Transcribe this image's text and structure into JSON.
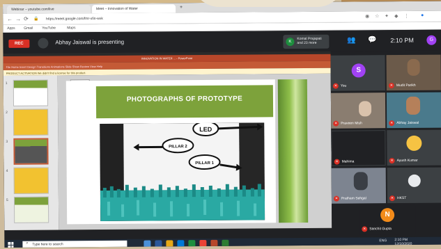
{
  "browser": {
    "tabs": [
      {
        "label": "Webinar – youtube.com/live"
      },
      {
        "label": "Meet – Innovation of Water"
      }
    ],
    "new_tab": "+",
    "url": "https://meet.google.com/fmr-xfin-wxk",
    "bookmarks": [
      "Apps",
      "Gmail",
      "YouTube",
      "Maps"
    ]
  },
  "meet": {
    "rec_label": "REC",
    "presenting_text": "Abhay Jaiswal is presenting",
    "pinned": {
      "initial": "K",
      "name_line1": "Komal Prajapati",
      "name_line2": "and 23 more"
    },
    "clock": "2:10 PM",
    "you_label": "You",
    "you_initial": "G"
  },
  "powerpoint": {
    "window_title": "INNOVATION IN WATER ... - PowerPoint",
    "ribbon": "File   Home   Insert   Design   Transitions   Animations   Slide Show   Review   View   Help",
    "notice": "PRODUCT ACTIVATION   We didn't find a license for this product.",
    "thumb_numbers": [
      "1",
      "2",
      "3",
      "4",
      "5"
    ],
    "slide_title": "PHOTOGRAPHS OF PROTOTYPE",
    "photo_labels": [
      "LED",
      "PILLAR 2",
      "PILLAR 1"
    ]
  },
  "participants": [
    {
      "name": "You",
      "initial": "S",
      "color": "#a142f4"
    },
    {
      "name": "Mudit Parikh",
      "initial": "",
      "color": "#6b5a4a"
    },
    {
      "name": "Praveen Mish",
      "initial": "",
      "color": "#8a7d70"
    },
    {
      "name": "Abhay Jaiswal",
      "initial": "",
      "color": "#4a7a8c"
    },
    {
      "name": "Mahima",
      "initial": "",
      "color": "#202124"
    },
    {
      "name": "Ayush Kumar",
      "initial": "",
      "color": "#f6c343"
    },
    {
      "name": "Pratham Sehgal",
      "initial": "",
      "color": "#7d8490"
    },
    {
      "name": "HKST",
      "initial": "",
      "color": "#3c4043"
    },
    {
      "name": "Sanchit Gupta",
      "initial": "N",
      "color": "#f28b1a"
    }
  ],
  "taskbar": {
    "search_placeholder": "Type here to search",
    "tray_time": "2:10 PM",
    "tray_date": "12/10/2020",
    "tray_lang": "ENG"
  }
}
